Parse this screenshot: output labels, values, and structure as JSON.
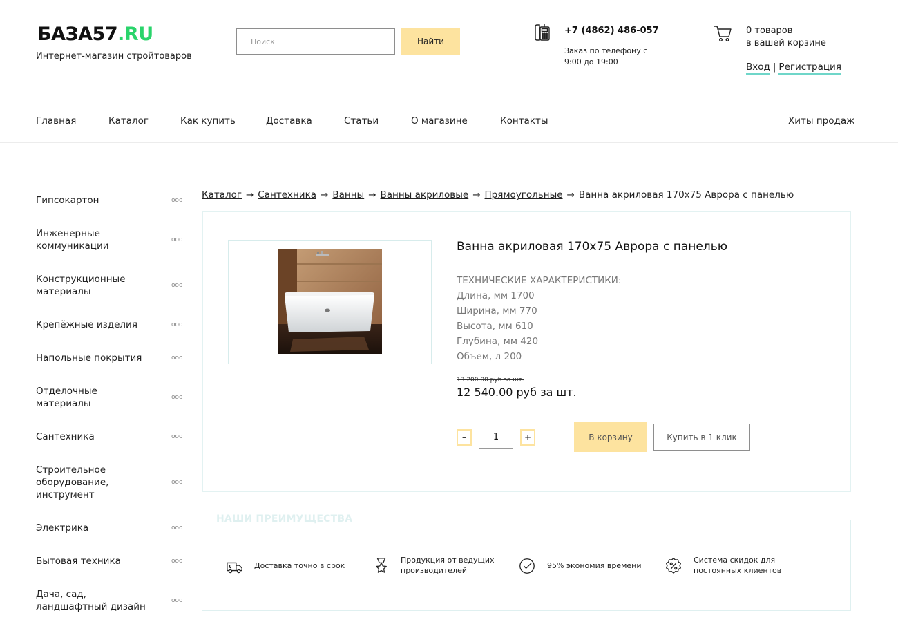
{
  "header": {
    "logo_main": "БАЗА57",
    "logo_suffix": ".RU",
    "tagline": "Интернет-магазин стройтоваров",
    "search_placeholder": "Поиск",
    "search_button": "Найти",
    "phone": "+7 (4862) 486-057",
    "phone_hours": "Заказ по телефону с 9:00 до 19:00",
    "cart_line1": "0 товаров",
    "cart_line2": "в вашей корзине",
    "login": "Вход",
    "separator": "|",
    "register": "Регистрация"
  },
  "nav": {
    "items": [
      "Главная",
      "Каталог",
      "Как купить",
      "Доставка",
      "Статьи",
      "О магазине",
      "Контакты"
    ],
    "hits": "Хиты продаж"
  },
  "sidebar": {
    "dots": "ооо",
    "categories": [
      "Гипсокартон",
      "Инженерные коммуникации",
      "Конструкционные материалы",
      "Крепёжные изделия",
      "Напольные покрытия",
      "Отделочные материалы",
      "Сантехника",
      "Строительное оборудование, инструмент",
      "Электрика",
      "Бытовая техника",
      "Дача, сад, ландшафтный дизайн"
    ]
  },
  "breadcrumb": {
    "links": [
      "Каталог",
      "Сантехника",
      "Ванны",
      "Ванны акриловые",
      "Прямоугольные"
    ],
    "arrow": "→",
    "current": "Ванна акриловая 170х75 Аврора с панелью"
  },
  "product": {
    "title": "Ванна акриловая 170х75 Аврора с панелью",
    "specs_heading": "ТЕХНИЧЕСКИЕ ХАРАКТЕРИСТИКИ:",
    "specs": [
      "Длина, мм 1700",
      "Ширина, мм 770",
      "Высота, мм 610",
      "Глубина, мм 420",
      "Объем, л 200"
    ],
    "old_price": "13 200.00 руб за шт.",
    "price": "12 540.00 руб за шт.",
    "qty_minus": "–",
    "qty_value": "1",
    "qty_plus": "+",
    "add_to_cart": "В корзину",
    "buy_one_click": "Купить в 1 клик"
  },
  "advantages": {
    "title": "НАШИ ПРЕИМУЩЕСТВА",
    "items": [
      {
        "text": "Доставка точно в срок",
        "icon": "truck-icon"
      },
      {
        "text": "Продукция от ведущих производителей",
        "icon": "award-icon"
      },
      {
        "text": "95% экономия времени",
        "icon": "check-circle-icon"
      },
      {
        "text": "Система скидок для постоянных клиентов",
        "icon": "percent-icon"
      }
    ]
  },
  "colors": {
    "accent_yellow": "#fde39f",
    "logo_green": "#2ad46b",
    "teal_border": "#6fd6c9",
    "card_border": "#e3f2f2"
  }
}
